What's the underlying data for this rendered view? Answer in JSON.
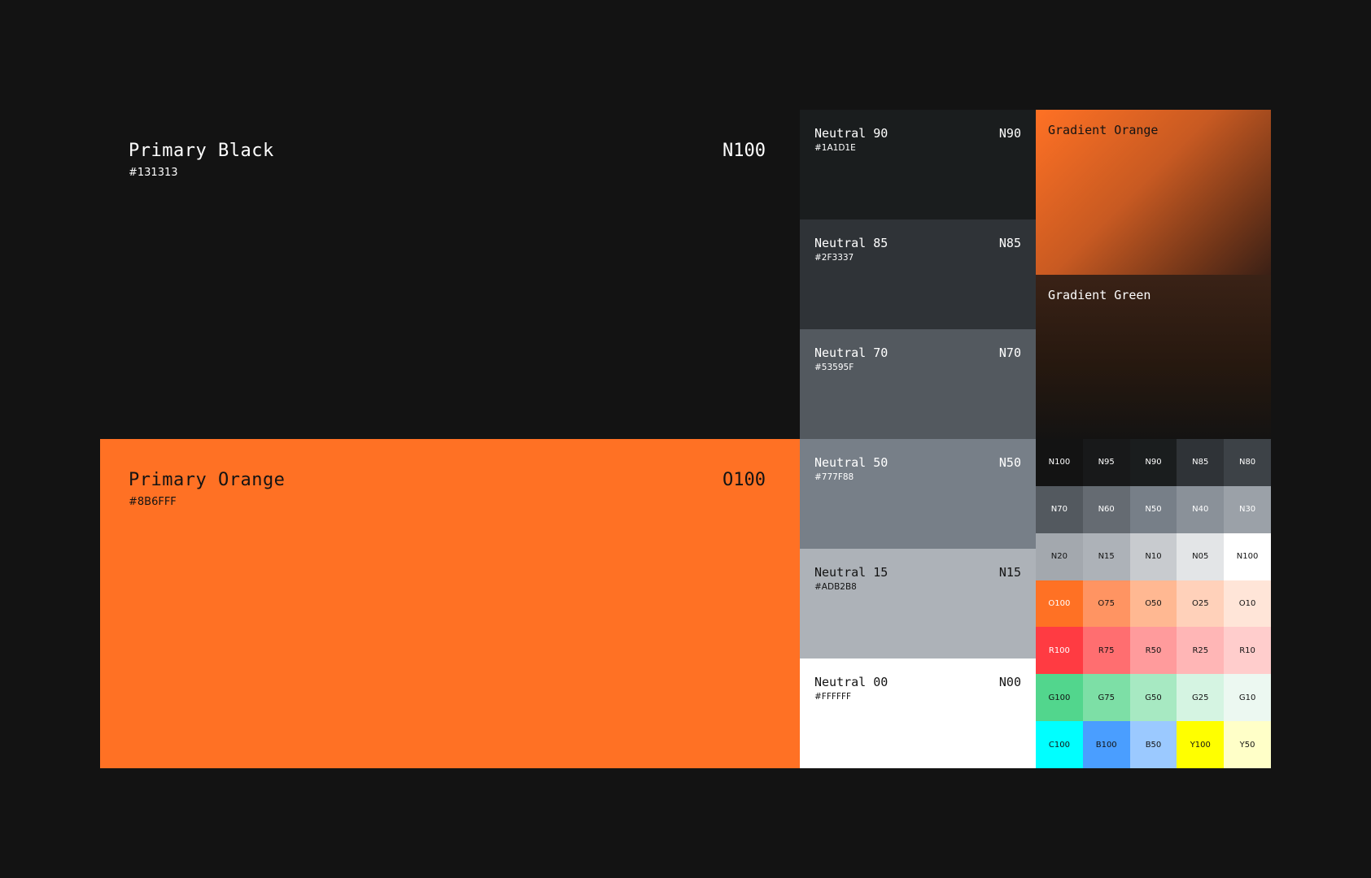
{
  "primary": [
    {
      "name": "Primary Black",
      "hex": "#131313",
      "code": "N100",
      "color": "#131313"
    },
    {
      "name": "Primary Orange",
      "hex": "#8B6FFF",
      "code": "O100",
      "color": "#FF7124"
    }
  ],
  "neutrals": [
    {
      "name": "Neutral 90",
      "hex": "#1A1D1E",
      "code": "N90",
      "color": "#1A1D1E",
      "text_color": "#FFFFFF"
    },
    {
      "name": "Neutral 85",
      "hex": "#2F3337",
      "code": "N85",
      "color": "#2F3337",
      "text_color": "#FFFFFF"
    },
    {
      "name": "Neutral 70",
      "hex": "#53595F",
      "code": "N70",
      "color": "#53595F",
      "text_color": "#FFFFFF"
    },
    {
      "name": "Neutral 50",
      "hex": "#777F88",
      "code": "N50",
      "color": "#777F88",
      "text_color": "#FFFFFF"
    },
    {
      "name": "Neutral 15",
      "hex": "#ADB2B8",
      "code": "N15",
      "color": "#ADB2B8",
      "text_color": "#131313"
    },
    {
      "name": "Neutral 00",
      "hex": "#FFFFFF",
      "code": "N00",
      "color": "#FFFFFF",
      "text_color": "#131313"
    }
  ],
  "gradients": [
    {
      "name": "Gradient Orange"
    },
    {
      "name": "Gradient Green"
    }
  ],
  "swatches": [
    {
      "label": "N100",
      "color": "#131313",
      "text": "#FFFFFF"
    },
    {
      "label": "N95",
      "color": "#18191A",
      "text": "#FFFFFF"
    },
    {
      "label": "N90",
      "color": "#1A1D1E",
      "text": "#FFFFFF"
    },
    {
      "label": "N85",
      "color": "#2F3337",
      "text": "#FFFFFF"
    },
    {
      "label": "N80",
      "color": "#3D4247",
      "text": "#FFFFFF"
    },
    {
      "label": "N70",
      "color": "#53595F",
      "text": "#FFFFFF"
    },
    {
      "label": "N60",
      "color": "#656B72",
      "text": "#FFFFFF"
    },
    {
      "label": "N50",
      "color": "#777F88",
      "text": "#FFFFFF"
    },
    {
      "label": "N40",
      "color": "#8A9199",
      "text": "#FFFFFF"
    },
    {
      "label": "N30",
      "color": "#9BA1A8",
      "text": "#FFFFFF"
    },
    {
      "label": "N20",
      "color": "#A3A8AE",
      "text": "#131313"
    },
    {
      "label": "N15",
      "color": "#ADB2B8",
      "text": "#131313"
    },
    {
      "label": "N10",
      "color": "#C8CBCF",
      "text": "#131313"
    },
    {
      "label": "N05",
      "color": "#E3E5E7",
      "text": "#131313"
    },
    {
      "label": "N100",
      "color": "#FFFFFF",
      "text": "#131313"
    },
    {
      "label": "O100",
      "color": "#FF7124",
      "text": "#FFFFFF"
    },
    {
      "label": "O75",
      "color": "#FF9462",
      "text": "#131313"
    },
    {
      "label": "O50",
      "color": "#FFB892",
      "text": "#131313"
    },
    {
      "label": "O25",
      "color": "#FFD1BA",
      "text": "#131313"
    },
    {
      "label": "O10",
      "color": "#FFE5D8",
      "text": "#131313"
    },
    {
      "label": "R100",
      "color": "#FF3B42",
      "text": "#FFFFFF"
    },
    {
      "label": "R75",
      "color": "#FF6E70",
      "text": "#131313"
    },
    {
      "label": "R50",
      "color": "#FF9B9C",
      "text": "#131313"
    },
    {
      "label": "R25",
      "color": "#FFB6B6",
      "text": "#131313"
    },
    {
      "label": "R10",
      "color": "#FFCDCC",
      "text": "#131313"
    },
    {
      "label": "G100",
      "color": "#52D68D",
      "text": "#131313"
    },
    {
      "label": "G75",
      "color": "#7DDFA6",
      "text": "#131313"
    },
    {
      "label": "G50",
      "color": "#A7E9C2",
      "text": "#131313"
    },
    {
      "label": "G25",
      "color": "#D5F4E2",
      "text": "#131313"
    },
    {
      "label": "G10",
      "color": "#ECF8F1",
      "text": "#131313"
    },
    {
      "label": "C100",
      "color": "#00FFFF",
      "text": "#131313"
    },
    {
      "label": "B100",
      "color": "#4A9EFF",
      "text": "#131313"
    },
    {
      "label": "B50",
      "color": "#9BC9FF",
      "text": "#131313"
    },
    {
      "label": "Y100",
      "color": "#FFFF00",
      "text": "#131313"
    },
    {
      "label": "Y50",
      "color": "#FFFFC8",
      "text": "#131313"
    }
  ]
}
